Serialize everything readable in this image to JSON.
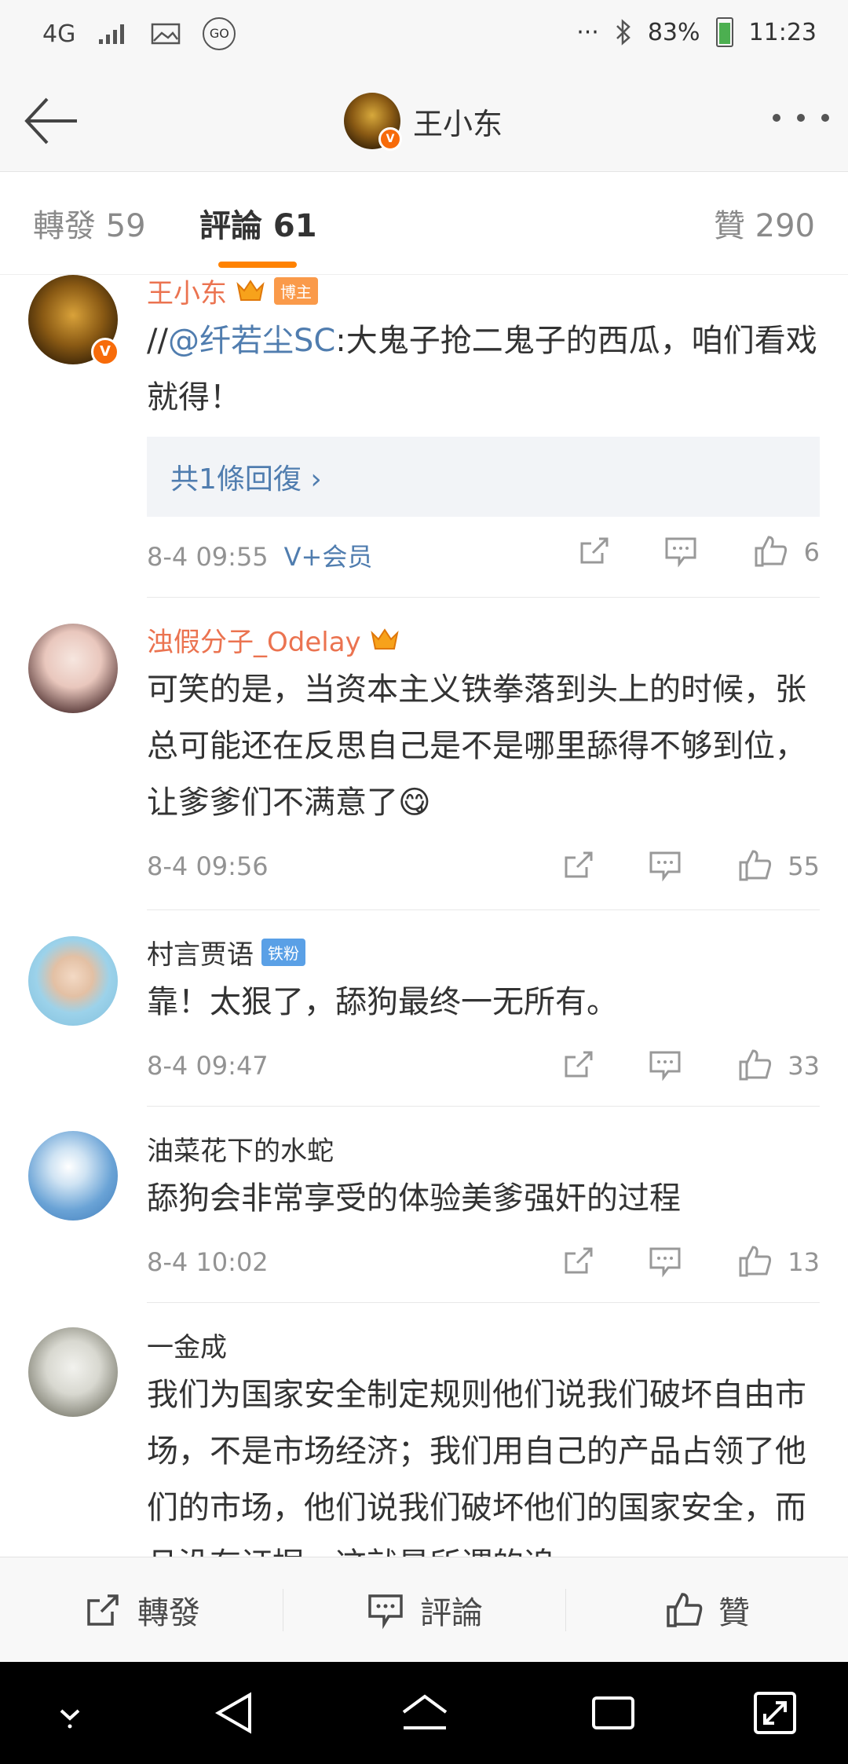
{
  "status_bar": {
    "network": "4G",
    "signal_icon": "signal-icon",
    "gallery_icon": "gallery-icon",
    "go_icon": "GO",
    "dots": "···",
    "bluetooth_icon": "bluetooth-icon",
    "battery": "83%",
    "time": "11:23"
  },
  "nav": {
    "title": "王小东",
    "avatar_badge": "V"
  },
  "tabs": [
    {
      "label": "轉發 59"
    },
    {
      "label": "評論 61"
    },
    {
      "label": "贊 290"
    }
  ],
  "comments": [
    {
      "name": "王小东",
      "badge": "博主",
      "text_prefix": "//",
      "mention": "@纤若尘SC",
      "text": ":大鬼子抢二鬼子的西瓜，咱们看戏就得！",
      "reply": "共1條回復 ›",
      "time": "8-4 09:55",
      "vip": "V+会员",
      "likes": "6"
    },
    {
      "name": "浊假分子_Odelay",
      "text": "可笑的是，当资本主义铁拳落到头上的时候，张总可能还在反思自己是不是哪里舔得不够到位，让爹爹们不满意了",
      "emoji": "😋",
      "time": "8-4 09:56",
      "likes": "55"
    },
    {
      "name": "村言贾语",
      "badge": "铁粉",
      "text": "靠！太狠了，舔狗最终一无所有。",
      "time": "8-4 09:47",
      "likes": "33"
    },
    {
      "name": "油菜花下的水蛇",
      "text": "舔狗会非常享受的体验美爹强奸的过程",
      "time": "8-4 10:02",
      "likes": "13"
    },
    {
      "name": "一金成",
      "text": "我们为国家安全制定规则他们说我们破坏自由市场，不是市场经济；我们用自己的产品占领了他们的市场，他们说我们破坏他们的国家安全，而且没有证据，这就是所谓的追"
    }
  ],
  "actions": {
    "repost": "轉發",
    "comment": "評論",
    "like": "贊"
  },
  "colors": {
    "accent": "#ff8200",
    "link": "#507daf",
    "vip_name": "#eb7350"
  }
}
